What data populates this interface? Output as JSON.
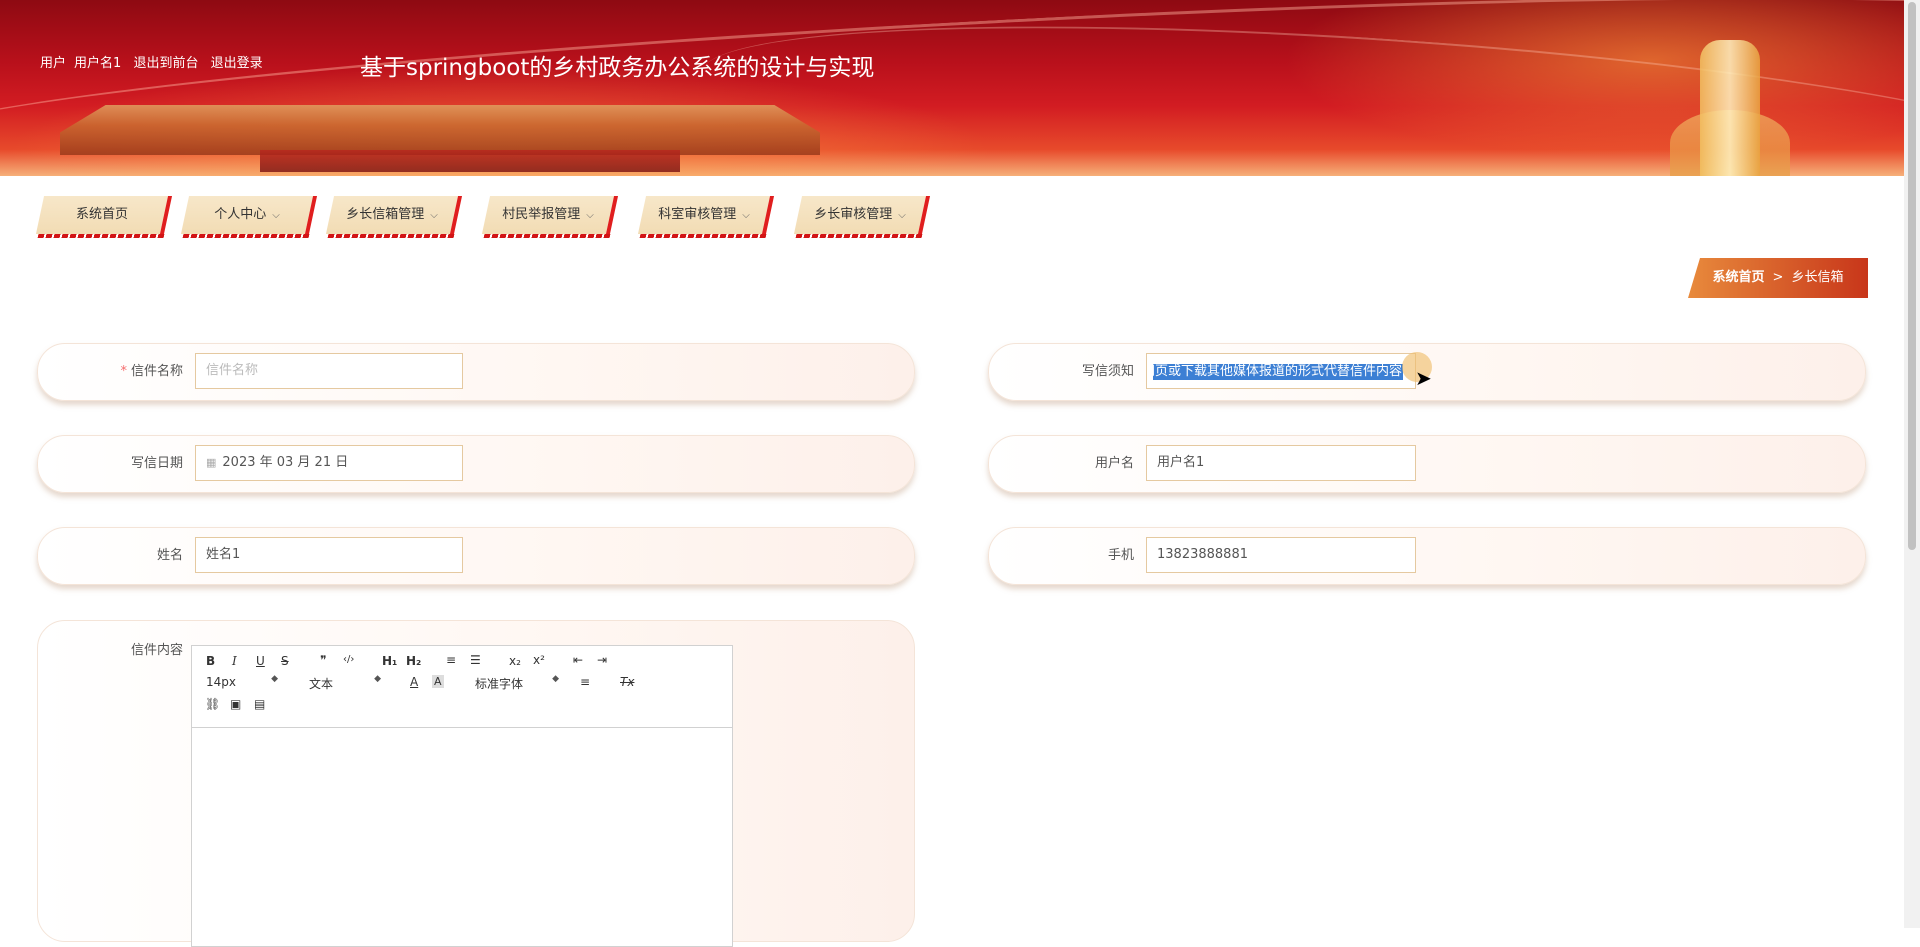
{
  "header": {
    "role": "用户",
    "username": "用户名1",
    "to_front": "退出到前台",
    "logout": "退出登录",
    "site_title": "基于springboot的乡村政务办公系统的设计与实现"
  },
  "nav": [
    {
      "label": "系统首页",
      "has_dropdown": false
    },
    {
      "label": "个人中心",
      "has_dropdown": true
    },
    {
      "label": "乡长信箱管理",
      "has_dropdown": true
    },
    {
      "label": "村民举报管理",
      "has_dropdown": true
    },
    {
      "label": "科室审核管理",
      "has_dropdown": true
    },
    {
      "label": "乡长审核管理",
      "has_dropdown": true
    }
  ],
  "breadcrumb": {
    "home": "系统首页",
    "separator": ">",
    "current": "乡长信箱"
  },
  "form": {
    "letter_name": {
      "label": "信件名称",
      "placeholder": "信件名称",
      "required": true
    },
    "notice": {
      "label": "写信须知",
      "value": "网页或下载其他媒体报道的形式代替信件内容"
    },
    "write_date": {
      "label": "写信日期",
      "value": "2023 年 03 月 21 日"
    },
    "username": {
      "label": "用户名",
      "value": "用户名1"
    },
    "name": {
      "label": "姓名",
      "value": "姓名1"
    },
    "phone": {
      "label": "手机",
      "value": "13823888881"
    },
    "content": {
      "label": "信件内容"
    }
  },
  "editor": {
    "font_size": "14px",
    "heading": "文本",
    "font_family": "标准字体",
    "buttons": {
      "bold": "B",
      "italic": "I",
      "underline": "U",
      "strike": "S",
      "blockquote": "❞",
      "code": "‹/›",
      "h1": "H₁",
      "h2": "H₂",
      "ordered_list": "≡",
      "bullet_list": "☰",
      "sub": "x₂",
      "sup": "x²",
      "outdent": "⇤",
      "indent": "⇥",
      "color": "A",
      "background": "A",
      "align": "≡",
      "clean": "Tx",
      "link": "⛓",
      "image": "▣",
      "video": "▤"
    }
  },
  "colors": {
    "accent": "#d21c22",
    "nav_bg": "#f2dcb4",
    "selection": "#3c7fd4"
  }
}
